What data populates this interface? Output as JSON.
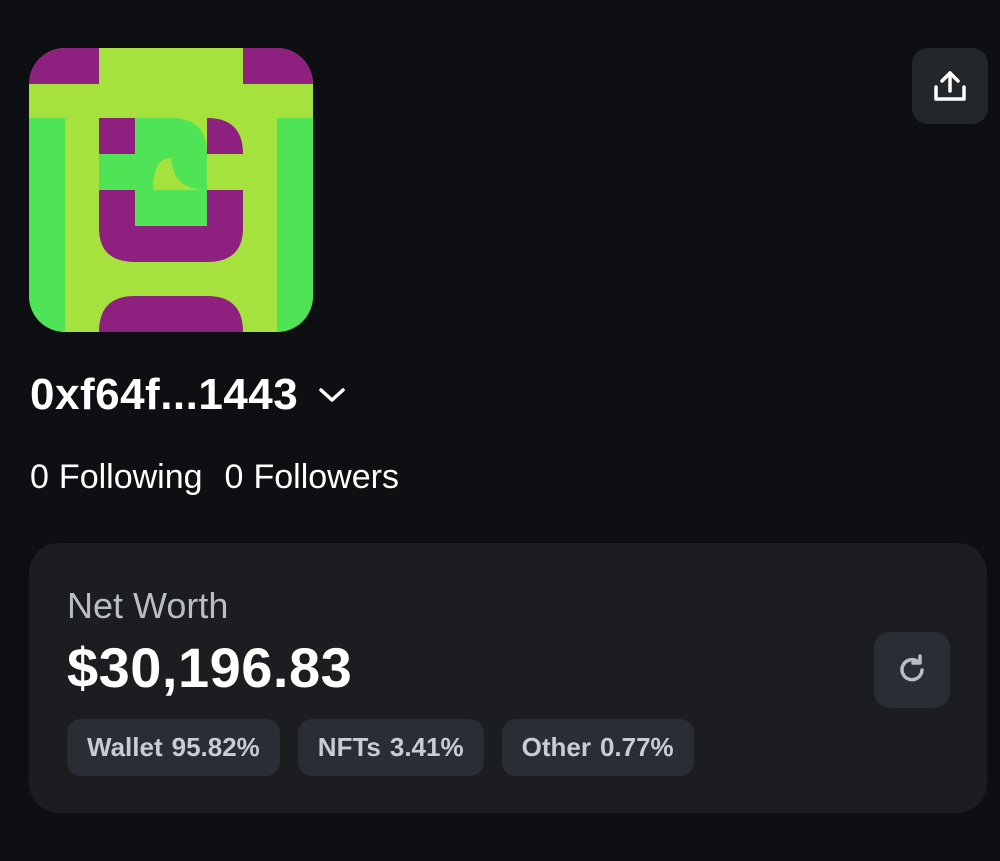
{
  "profile": {
    "address": "0xf64f...1443",
    "following_count": "0",
    "following_label": "Following",
    "followers_count": "0",
    "followers_label": "Followers"
  },
  "icons": {
    "share": "share-upload-icon",
    "address_menu": "chevron-down-icon",
    "refresh": "refresh-icon",
    "avatar": "generated-avatar"
  },
  "net_worth": {
    "label": "Net Worth",
    "value": "$30,196.83",
    "breakdown": [
      {
        "name": "Wallet",
        "percent": "95.82%"
      },
      {
        "name": "NFTs",
        "percent": "3.41%"
      },
      {
        "name": "Other",
        "percent": "0.77%"
      }
    ]
  },
  "colors": {
    "background": "#0e0f12",
    "card": "#1b1d21",
    "button": "#23262b",
    "avatar_lime": "#a6e23e",
    "avatar_green": "#4ee455",
    "avatar_purple": "#8e2080"
  }
}
